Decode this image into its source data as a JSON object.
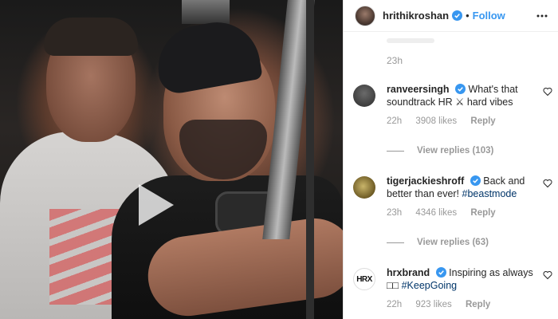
{
  "post": {
    "username": "hrithikroshan",
    "follow_label": "Follow",
    "separator": "•"
  },
  "previous_comment": {
    "time": "23h"
  },
  "comments": [
    {
      "username": "ranveersingh",
      "text": "What's that soundtrack HR ⚔ hard vibes",
      "hashtag": "",
      "time": "22h",
      "likes": "3908 likes",
      "reply_label": "Reply",
      "view_replies": "View replies (103)"
    },
    {
      "username": "tigerjackieshroff",
      "text": "Back and better than ever!",
      "hashtag": "#beastmode",
      "time": "23h",
      "likes": "4346 likes",
      "reply_label": "Reply",
      "view_replies": "View replies (63)"
    },
    {
      "username": "hrxbrand",
      "text": "Inspiring as always □□",
      "hashtag": "#KeepGoing",
      "time": "22h",
      "likes": "923 likes",
      "reply_label": "Reply",
      "avatar_logo": "HRX"
    }
  ],
  "icons": {
    "verified": "verified-badge-icon",
    "more": "more-options-icon",
    "heart": "heart-outline-icon",
    "play": "play-icon"
  },
  "colors": {
    "accent": "#3897f0",
    "hashtag": "#003569",
    "meta": "#999999"
  }
}
